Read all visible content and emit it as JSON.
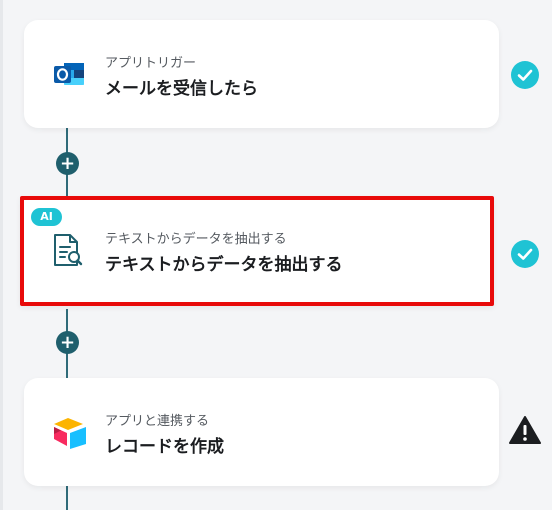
{
  "flow": {
    "steps": [
      {
        "subtitle": "アプリトリガー",
        "title": "メールを受信したら",
        "icon": "outlook-icon",
        "status": "complete",
        "status_icon": "check-circle-icon"
      },
      {
        "badge": "AI",
        "subtitle": "テキストからデータを抽出する",
        "title": "テキストからデータを抽出する",
        "icon": "document-search-icon",
        "status": "complete",
        "status_icon": "check-circle-icon",
        "selected": true
      },
      {
        "subtitle": "アプリと連携する",
        "title": "レコードを作成",
        "icon": "airtable-icon",
        "status": "warning",
        "status_icon": "warning-icon"
      }
    ],
    "add_button_label": "+"
  },
  "colors": {
    "card_bg": "#ffffff",
    "page_bg": "#f4f5f7",
    "connector": "#1f5f6d",
    "check": "#1fc3d4",
    "warning": "#1b1d20",
    "selection_border": "#e80a0a",
    "ai_badge": "#1fc3d4"
  }
}
